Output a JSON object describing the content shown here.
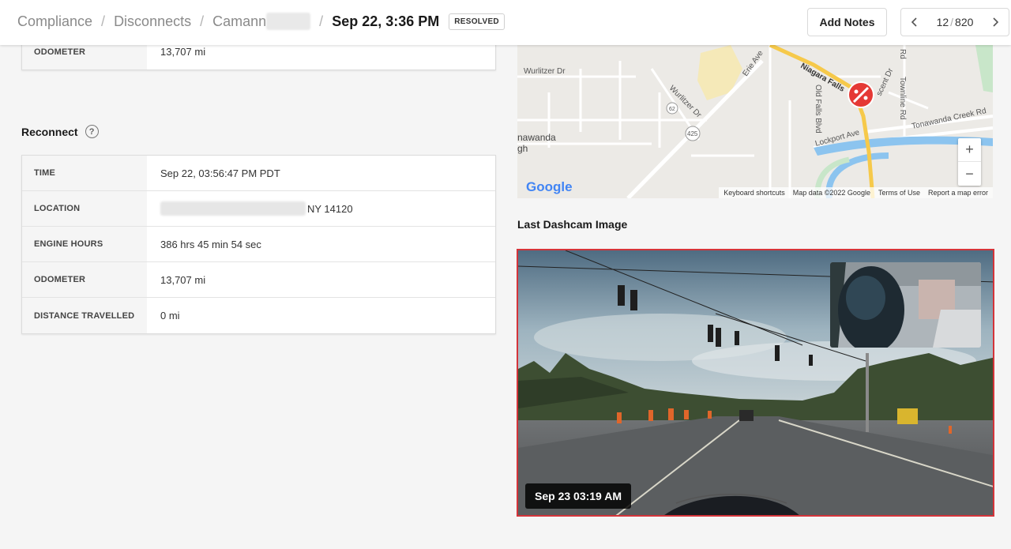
{
  "breadcrumb": {
    "items": [
      "Compliance",
      "Disconnects",
      "Camann"
    ],
    "current": "Sep 22, 3:36 PM",
    "status_badge": "RESOLVED"
  },
  "toolbar": {
    "add_notes_label": "Add Notes",
    "pager_current": "12",
    "pager_total": "820"
  },
  "disconnect_partial": {
    "rows": [
      {
        "label": "ODOMETER",
        "value": "13,707 mi"
      }
    ]
  },
  "reconnect": {
    "title": "Reconnect",
    "help_glyph": "?",
    "rows": [
      {
        "label": "TIME",
        "value": "Sep 22, 03:56:47 PM PDT"
      },
      {
        "label": "LOCATION",
        "value": "NY 14120"
      },
      {
        "label": "ENGINE HOURS",
        "value": "386 hrs 45 min 54 sec"
      },
      {
        "label": "ODOMETER",
        "value": "13,707 mi"
      },
      {
        "label": "DISTANCE TRAVELLED",
        "value": "0 mi"
      }
    ]
  },
  "map": {
    "labels": {
      "wurlitzer_dr": "Wurlitzer Dr",
      "wurlitzer_dr_2": "Wurlitzer Dr",
      "erie_ave": "Erie Ave",
      "niagara_falls": "Niagara Falls",
      "old_falls_blvd": "Old Falls Blvd",
      "townline_rd": "Townline Rd",
      "crescent_dr": "scent Dr",
      "rd": "Rd",
      "tonawanda_creek_rd": "Tonawanda Creek Rd",
      "lockport_ave": "Lockport Ave",
      "tonawanda": "nawanda",
      "gh": "gh",
      "route_425": "425",
      "route_62": "62"
    },
    "zoom_in": "+",
    "zoom_out": "−",
    "google_logo": "Google",
    "attribution": [
      "Keyboard shortcuts",
      "Map data ©2022 Google",
      "Terms of Use",
      "Report a map error"
    ],
    "colors": {
      "marker": "#e53935",
      "road_major": "#f6c94a",
      "water": "#8cc4ef",
      "park": "#c8e6c9"
    }
  },
  "dashcam": {
    "title": "Last Dashcam Image",
    "timestamp": "Sep 23 03:19 AM",
    "border_color": "#d4343a"
  },
  "icons": {
    "prev": "chevron-left-icon",
    "next": "chevron-right-icon",
    "help": "question-circle-icon",
    "marker": "disconnect-marker-icon"
  }
}
